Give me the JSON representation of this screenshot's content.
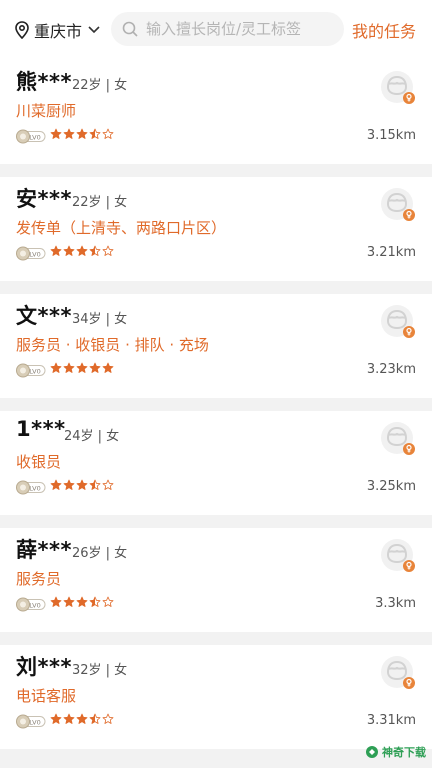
{
  "header": {
    "city": "重庆市",
    "search_placeholder": "输入擅长岗位/灵工标签",
    "my_tasks": "我的任务"
  },
  "workers": [
    {
      "name": "熊***",
      "age_gender": "22岁 | 女",
      "job": "川菜厨师",
      "level": "LV0",
      "rating": 3.5,
      "distance": "3.15km"
    },
    {
      "name": "安***",
      "age_gender": "22岁 | 女",
      "job": "发传单（上清寺、两路口片区）",
      "level": "LV0",
      "rating": 3.5,
      "distance": "3.21km"
    },
    {
      "name": "文***",
      "age_gender": "34岁 | 女",
      "job": "服务员 · 收银员 · 排队 · 充场",
      "level": "LV0",
      "rating": 5,
      "distance": "3.23km"
    },
    {
      "name": "1***",
      "age_gender": "24岁 | 女",
      "job": "收银员",
      "level": "LV0",
      "rating": 3.5,
      "distance": "3.25km"
    },
    {
      "name": "薛***",
      "age_gender": "26岁 | 女",
      "job": "服务员",
      "level": "LV0",
      "rating": 3.5,
      "distance": "3.3km"
    },
    {
      "name": "刘***",
      "age_gender": "32岁 | 女",
      "job": "电话客服",
      "level": "LV0",
      "rating": 3.5,
      "distance": "3.31km"
    }
  ],
  "watermark": "神奇下载",
  "colors": {
    "accent": "#e06a2a",
    "female": "#e8843a"
  }
}
